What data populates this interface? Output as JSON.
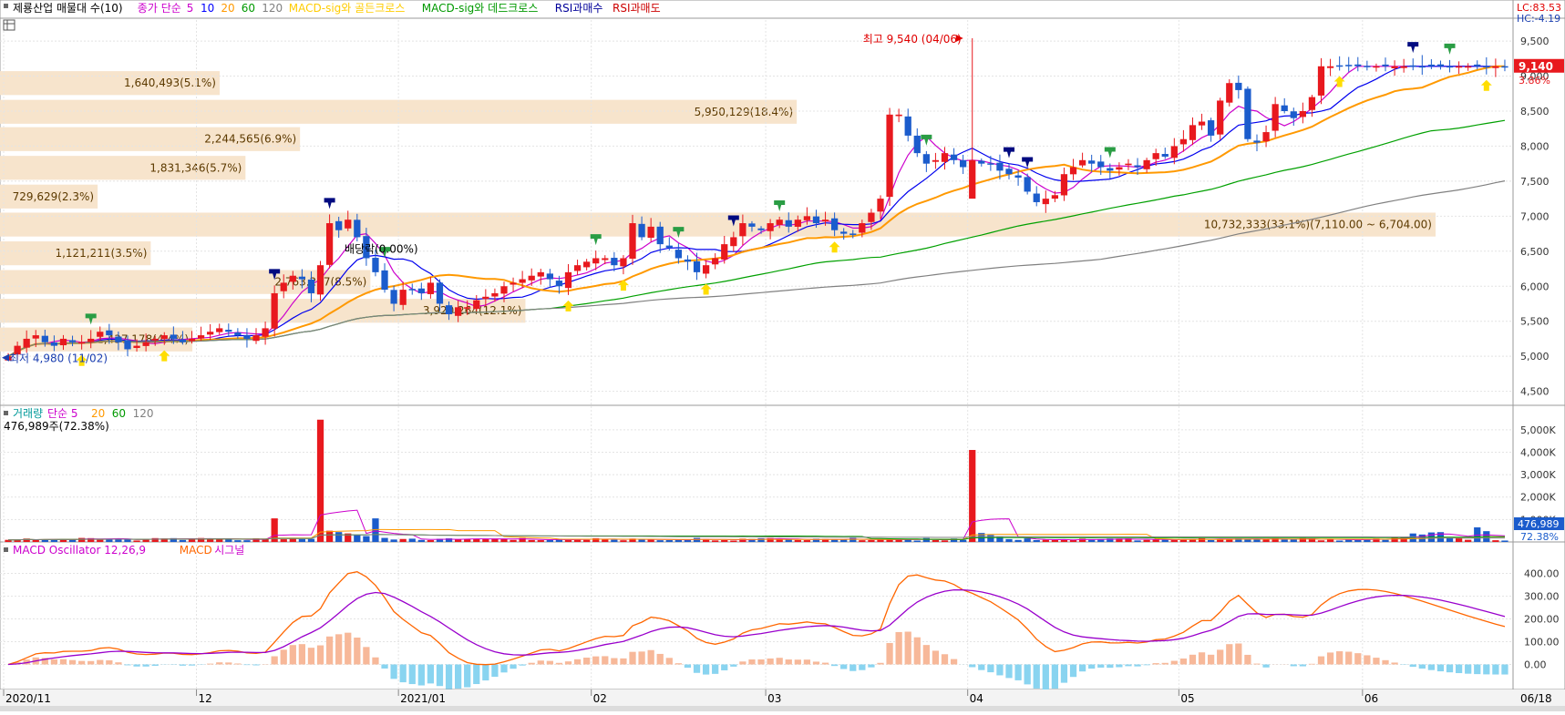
{
  "price_panel": {
    "legend": [
      {
        "text": "제룡산업 매물대 수(10)",
        "color": "#000000"
      },
      {
        "text": "종가 단순",
        "color": "#cc00cc"
      },
      {
        "text": "5",
        "color": "#cc00cc"
      },
      {
        "text": "10",
        "color": "#0000ff"
      },
      {
        "text": "20",
        "color": "#ff9900"
      },
      {
        "text": "60",
        "color": "#009900"
      },
      {
        "text": "120",
        "color": "#808080"
      },
      {
        "text": "MACD-sig와 골든크로스",
        "color": "#ffcc00"
      },
      {
        "text": "MACD-sig와 데드크로스",
        "color": "#009900"
      },
      {
        "text": "RSI과매수",
        "color": "#000099"
      },
      {
        "text": "RSI과매도",
        "color": "#cc0000"
      }
    ],
    "lc": "LC:83.53",
    "hc": "HC:-4.19",
    "ymin": 4300,
    "ymax": 9800,
    "ticks": [
      "9,500",
      "9,000",
      "8,500",
      "8,000",
      "7,500",
      "7,000",
      "6,500",
      "6,000",
      "5,500",
      "5,000",
      "4,500"
    ],
    "tick_values": [
      9500,
      9000,
      8500,
      8000,
      7500,
      7000,
      6500,
      6000,
      5500,
      5000,
      4500
    ],
    "current_price_label": "9,140",
    "current_price": 9140,
    "current_change": "3.86%",
    "high_annotation": "최고 9,540 (04/06)",
    "low_annotation": "최저 4,980 (11/02)",
    "dividend_annotation": "배당락(0.00%)",
    "volume_profile": [
      {
        "label": "1,640,493(5.1%)",
        "price": 8900,
        "frac": 0.153
      },
      {
        "label": "5,950,129(18.4%)",
        "price": 8490,
        "frac": 0.555
      },
      {
        "label": "2,244,565(6.9%)",
        "price": 8100,
        "frac": 0.209
      },
      {
        "label": "1,831,346(5.7%)",
        "price": 7690,
        "frac": 0.171
      },
      {
        "label": "729,629(2.3%)",
        "price": 7280,
        "frac": 0.068
      },
      {
        "label": "10,732,333(33.1%)(7,110.00 ~ 6,704.00)",
        "price": 6880,
        "frac": 1.0
      },
      {
        "label": "1,121,211(3.5%)",
        "price": 6470,
        "frac": 0.105
      },
      {
        "label": "2,763,257(8.5%)",
        "price": 6060,
        "frac": 0.258
      },
      {
        "label": "3,920,264(12.1%)",
        "price": 5650,
        "frac": 0.366
      },
      {
        "label": "1,437,178(4.4%)",
        "price": 5240,
        "frac": 0.134
      }
    ]
  },
  "volume_panel": {
    "legend": [
      {
        "text": "거래량",
        "color": "#009999"
      },
      {
        "text": "단순 5",
        "color": "#cc00cc"
      },
      {
        "text": "20",
        "color": "#ff9900"
      },
      {
        "text": "60",
        "color": "#009900"
      },
      {
        "text": "120",
        "color": "#808080"
      }
    ],
    "summary": "476,989주(72.38%)",
    "ymax": 5400,
    "ticks": [
      "5,000K",
      "4,000K",
      "3,000K",
      "2,000K",
      "1,000K"
    ],
    "tick_values": [
      5000,
      4000,
      3000,
      2000,
      1000
    ],
    "current_label": "476,989",
    "current_pct": "72.38%"
  },
  "macd_panel": {
    "legend": [
      {
        "text": "MACD Oscillator 12,26,9",
        "color": "#cc00cc"
      },
      {
        "text": "MACD",
        "color": "#ff6600"
      },
      {
        "text": "시그널",
        "color": "#cc00cc"
      }
    ],
    "ymin": -110,
    "ymax": 470,
    "ticks": [
      "400.00",
      "300.00",
      "200.00",
      "100.00",
      "0.00"
    ],
    "tick_values": [
      400,
      300,
      200,
      100,
      0
    ]
  },
  "x_axis": {
    "labels": [
      {
        "text": "2020/11",
        "idx": 0
      },
      {
        "text": "12",
        "idx": 21
      },
      {
        "text": "2021/01",
        "idx": 43
      },
      {
        "text": "02",
        "idx": 64
      },
      {
        "text": "03",
        "idx": 83
      },
      {
        "text": "04",
        "idx": 105
      },
      {
        "text": "05",
        "idx": 128
      },
      {
        "text": "06",
        "idx": 148
      }
    ],
    "last_date": "06/18"
  },
  "chart_data": [
    {
      "type": "candlestick",
      "title": "제룡산업",
      "period": "2020/11 ~ 06/18 (daily)",
      "series_note": "approximate reading of daily closes",
      "closes": [
        5000,
        5150,
        5250,
        5300,
        5200,
        5150,
        5250,
        5200,
        5200,
        5250,
        5350,
        5300,
        5200,
        5100,
        5150,
        5200,
        5250,
        5300,
        5250,
        5200,
        5250,
        5300,
        5350,
        5400,
        5350,
        5300,
        5250,
        5300,
        5400,
        5900,
        6050,
        6150,
        6100,
        5900,
        6300,
        6900,
        6800,
        6950,
        6700,
        6400,
        6200,
        5950,
        5750,
        5950,
        5950,
        5900,
        6050,
        5750,
        5600,
        5700,
        5700,
        5800,
        5850,
        5900,
        6000,
        6050,
        6100,
        6150,
        6200,
        6100,
        6000,
        6200,
        6300,
        6350,
        6400,
        6400,
        6300,
        6400,
        6900,
        6700,
        6850,
        6600,
        6550,
        6400,
        6350,
        6200,
        6300,
        6400,
        6600,
        6700,
        6900,
        6850,
        6800,
        6900,
        6950,
        6850,
        6950,
        7000,
        6900,
        6950,
        6800,
        6750,
        6750,
        6900,
        7050,
        7250,
        8450,
        8450,
        8150,
        7900,
        7750,
        7800,
        7900,
        7800,
        7700,
        7800,
        7750,
        7750,
        7650,
        7600,
        7550,
        7350,
        7200,
        7250,
        7300,
        7600,
        7700,
        7800,
        7750,
        7700,
        7650,
        7700,
        7750,
        7700,
        7800,
        7900,
        7850,
        8000,
        8100,
        8300,
        8350,
        8150,
        8650,
        8900,
        8800,
        8100,
        8050,
        8200,
        8600,
        8500,
        8400,
        8500,
        8700,
        9140
      ]
    },
    {
      "type": "bar",
      "title": "거래량",
      "unit": "K shares",
      "notable_values": {
        "2020-12 spike": 5450,
        "04/06 spike": 4100,
        "latest": 477
      }
    },
    {
      "type": "line",
      "title": "MACD Oscillator 12,26,9",
      "series": [
        {
          "name": "MACD",
          "peaks": [
            450,
            410,
            270,
            250
          ]
        },
        {
          "name": "시그널",
          "peaks": [
            330,
            320,
            200
          ]
        }
      ]
    }
  ]
}
